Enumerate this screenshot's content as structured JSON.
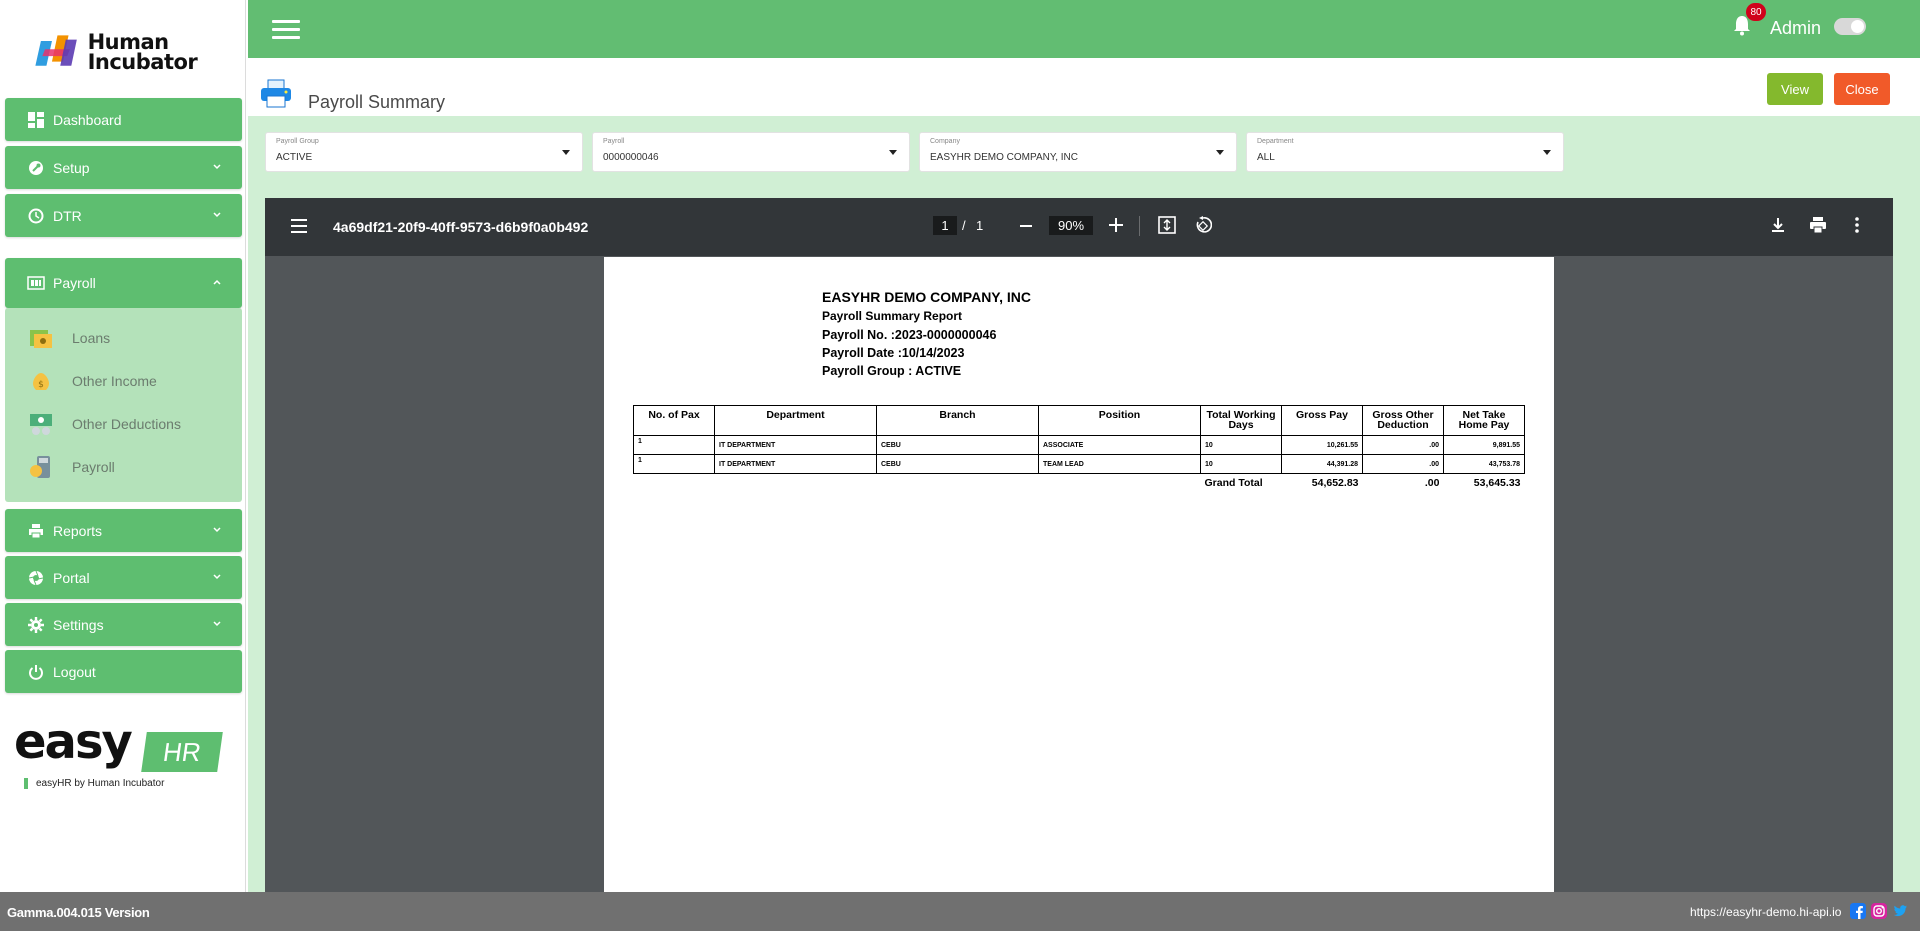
{
  "sidebar": {
    "logo_text": "Human Incubator",
    "items": {
      "dashboard": "Dashboard",
      "setup": "Setup",
      "dtr": "DTR",
      "payroll": "Payroll",
      "reports": "Reports",
      "portal": "Portal",
      "settings": "Settings",
      "logout": "Logout"
    },
    "payroll_sub": {
      "loans": "Loans",
      "other_income": "Other Income",
      "other_deductions": "Other Deductions",
      "payroll": "Payroll"
    },
    "easyhr_text": "easy",
    "easyhr_hr": "HR",
    "easyhr_by": "easyHR by Human Incubator"
  },
  "topbar": {
    "notification_count": "80",
    "user": "Admin"
  },
  "header": {
    "title": "Payroll Summary",
    "view_label": "View",
    "close_label": "Close"
  },
  "filters": {
    "payroll_group": {
      "label": "Payroll Group",
      "value": "ACTIVE"
    },
    "payroll": {
      "label": "Payroll",
      "value": "0000000046"
    },
    "company": {
      "label": "Company",
      "value": "EASYHR DEMO COMPANY, INC"
    },
    "department": {
      "label": "Department",
      "value": "ALL"
    }
  },
  "viewer": {
    "file_name": "4a69df21-20f9-40ff-9573-d6b9f0a0b492",
    "page": "1",
    "page_sep": "/",
    "total_pages": "1",
    "zoom": "90%"
  },
  "report": {
    "company": "EASYHR DEMO COMPANY, INC",
    "title": "Payroll Summary Report",
    "payroll_no": "Payroll No. :2023-0000000046",
    "payroll_date": "Payroll Date :10/14/2023",
    "payroll_group": "Payroll Group : ACTIVE",
    "columns": {
      "pax": "No. of Pax",
      "department": "Department",
      "branch": "Branch",
      "position": "Position",
      "days_1": "Total Working",
      "days_2": "Days",
      "gross": "Gross Pay",
      "deduction_1": "Gross Other",
      "deduction_2": "Deduction",
      "net_1": "Net Take",
      "net_2": "Home Pay"
    },
    "rows": [
      {
        "pax": "1",
        "department": "IT DEPARTMENT",
        "branch": "CEBU",
        "position": "ASSOCIATE",
        "days": "10",
        "gross": "10,261.55",
        "deduction": ".00",
        "net": "9,891.55"
      },
      {
        "pax": "1",
        "department": "IT DEPARTMENT",
        "branch": "CEBU",
        "position": "TEAM LEAD",
        "days": "10",
        "gross": "44,391.28",
        "deduction": ".00",
        "net": "43,753.78"
      }
    ],
    "total": {
      "label": "Grand Total",
      "gross": "54,652.83",
      "deduction": ".00",
      "net": "53,645.33"
    }
  },
  "footer": {
    "version": "Gamma.004.015 Version",
    "url": "https://easyhr-demo.hi-api.io"
  },
  "colors": {
    "primary_green": "#5ebe70",
    "light_green": "#d0efd4",
    "view_button": "#84b92d",
    "close_button": "#f15a29"
  }
}
